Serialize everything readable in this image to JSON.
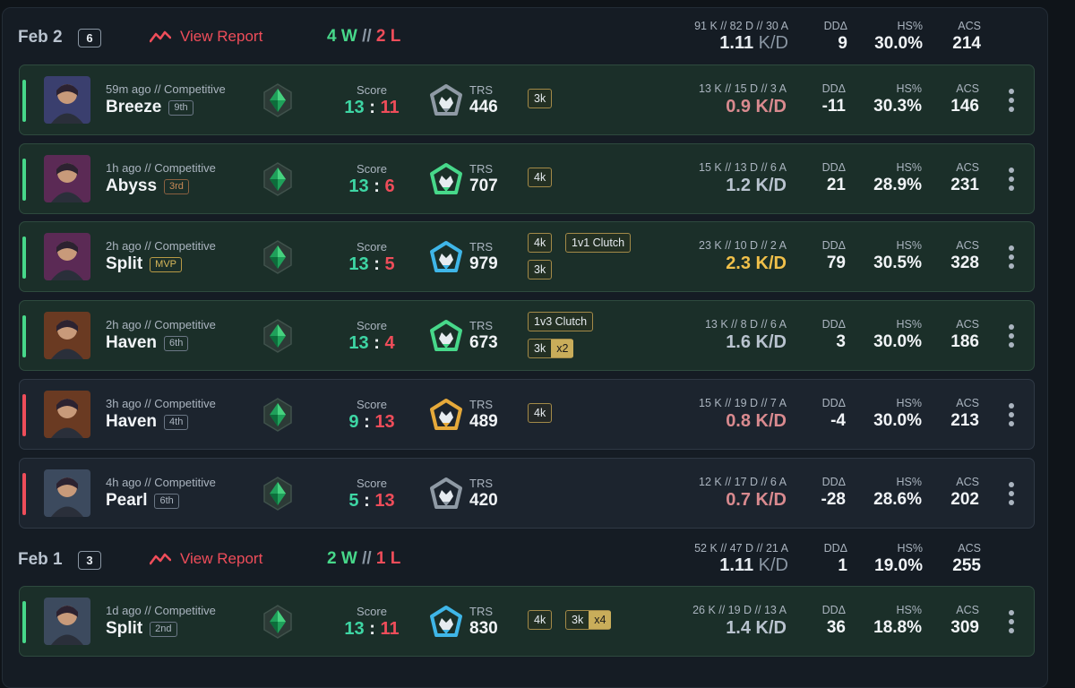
{
  "days": [
    {
      "date": "Feb 2",
      "count": "6",
      "report": "View Report",
      "wins": "4 W",
      "sep": "//",
      "losses": "2 L",
      "kda": "91 K // 82 D // 30 A",
      "kd_value": "1.11",
      "kd_unit": "K/D",
      "dd_label": "DDΔ",
      "dd": "9",
      "hs_label": "HS%",
      "hs": "30.0%",
      "acs_label": "ACS",
      "acs": "214"
    },
    {
      "date": "Feb 1",
      "count": "3",
      "report": "View Report",
      "wins": "2 W",
      "sep": "//",
      "losses": "1 L",
      "kda": "52 K // 47 D // 21 A",
      "kd_value": "1.11",
      "kd_unit": "K/D",
      "dd_label": "DDΔ",
      "dd": "1",
      "hs_label": "HS%",
      "hs": "19.0%",
      "acs_label": "ACS",
      "acs": "255"
    }
  ],
  "matches": [
    {
      "result": "win",
      "ago": "59m ago // Competitive",
      "map": "Breeze",
      "place": "9th",
      "score_label": "Score",
      "score_a": "13",
      "score_b": "11",
      "trs_label": "TRS",
      "trs": "446",
      "tags": [
        "3k"
      ],
      "kda": "13 K // 15 D // 3 A",
      "kd": "0.9 K/D",
      "dd_label": "DDΔ",
      "dd": "-11",
      "hs_label": "HS%",
      "hs": "30.3%",
      "acs_label": "ACS",
      "acs": "146"
    },
    {
      "result": "win",
      "ago": "1h ago // Competitive",
      "map": "Abyss",
      "place": "3rd",
      "score_label": "Score",
      "score_a": "13",
      "score_b": "6",
      "trs_label": "TRS",
      "trs": "707",
      "tags": [
        "4k"
      ],
      "kda": "15 K // 13 D // 6 A",
      "kd": "1.2 K/D",
      "dd_label": "DDΔ",
      "dd": "21",
      "hs_label": "HS%",
      "hs": "28.9%",
      "acs_label": "ACS",
      "acs": "231"
    },
    {
      "result": "win",
      "ago": "2h ago // Competitive",
      "map": "Split",
      "place": "MVP",
      "score_label": "Score",
      "score_a": "13",
      "score_b": "5",
      "trs_label": "TRS",
      "trs": "979",
      "tags": [
        "4k",
        "1v1 Clutch",
        "3k"
      ],
      "kda": "23 K // 10 D // 2 A",
      "kd": "2.3 K/D",
      "dd_label": "DDΔ",
      "dd": "79",
      "hs_label": "HS%",
      "hs": "30.5%",
      "acs_label": "ACS",
      "acs": "328"
    },
    {
      "result": "win",
      "ago": "2h ago // Competitive",
      "map": "Haven",
      "place": "6th",
      "score_label": "Score",
      "score_a": "13",
      "score_b": "4",
      "trs_label": "TRS",
      "trs": "673",
      "tags": [
        "1v3 Clutch",
        "3k",
        "x2"
      ],
      "kda": "13 K // 8 D // 6 A",
      "kd": "1.6 K/D",
      "dd_label": "DDΔ",
      "dd": "3",
      "hs_label": "HS%",
      "hs": "30.0%",
      "acs_label": "ACS",
      "acs": "186"
    },
    {
      "result": "loss",
      "ago": "3h ago // Competitive",
      "map": "Haven",
      "place": "4th",
      "score_label": "Score",
      "score_a": "9",
      "score_b": "13",
      "trs_label": "TRS",
      "trs": "489",
      "tags": [
        "4k"
      ],
      "kda": "15 K // 19 D // 7 A",
      "kd": "0.8 K/D",
      "dd_label": "DDΔ",
      "dd": "-4",
      "hs_label": "HS%",
      "hs": "30.0%",
      "acs_label": "ACS",
      "acs": "213"
    },
    {
      "result": "loss",
      "ago": "4h ago // Competitive",
      "map": "Pearl",
      "place": "6th",
      "score_label": "Score",
      "score_a": "5",
      "score_b": "13",
      "trs_label": "TRS",
      "trs": "420",
      "tags": [],
      "kda": "12 K // 17 D // 6 A",
      "kd": "0.7 K/D",
      "dd_label": "DDΔ",
      "dd": "-28",
      "hs_label": "HS%",
      "hs": "28.6%",
      "acs_label": "ACS",
      "acs": "202"
    },
    {
      "result": "win",
      "ago": "1d ago // Competitive",
      "map": "Split",
      "place": "2nd",
      "score_label": "Score",
      "score_a": "13",
      "score_b": "11",
      "trs_label": "TRS",
      "trs": "830",
      "tags": [
        "4k",
        "3k",
        "x4"
      ],
      "kda": "26 K // 19 D // 13 A",
      "kd": "1.4 K/D",
      "dd_label": "DDΔ",
      "dd": "36",
      "hs_label": "HS%",
      "hs": "18.8%",
      "acs_label": "ACS",
      "acs": "309"
    }
  ],
  "icons": {
    "report": "trend-line-icon",
    "rank": "emerald-rank-icon",
    "trs": "crown-emblem-icon",
    "more": "vertical-dots-icon"
  },
  "colors": {
    "win": "#47d88a",
    "loss": "#ef4d5a",
    "accent_gold": "#c9ad5a",
    "bg": "#151c24"
  }
}
